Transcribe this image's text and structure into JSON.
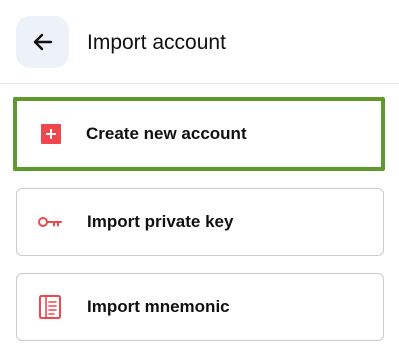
{
  "header": {
    "title": "Import account",
    "back_icon": "arrow-left-icon"
  },
  "options": [
    {
      "label": "Create new account",
      "icon": "plus-square-icon",
      "selected": true
    },
    {
      "label": "Import private key",
      "icon": "key-icon",
      "selected": false
    },
    {
      "label": "Import mnemonic",
      "icon": "document-icon",
      "selected": false
    }
  ],
  "colors": {
    "accent_red": "#f0474f",
    "selection_border": "#5e9a2b",
    "back_button_bg": "#edf1f8"
  }
}
